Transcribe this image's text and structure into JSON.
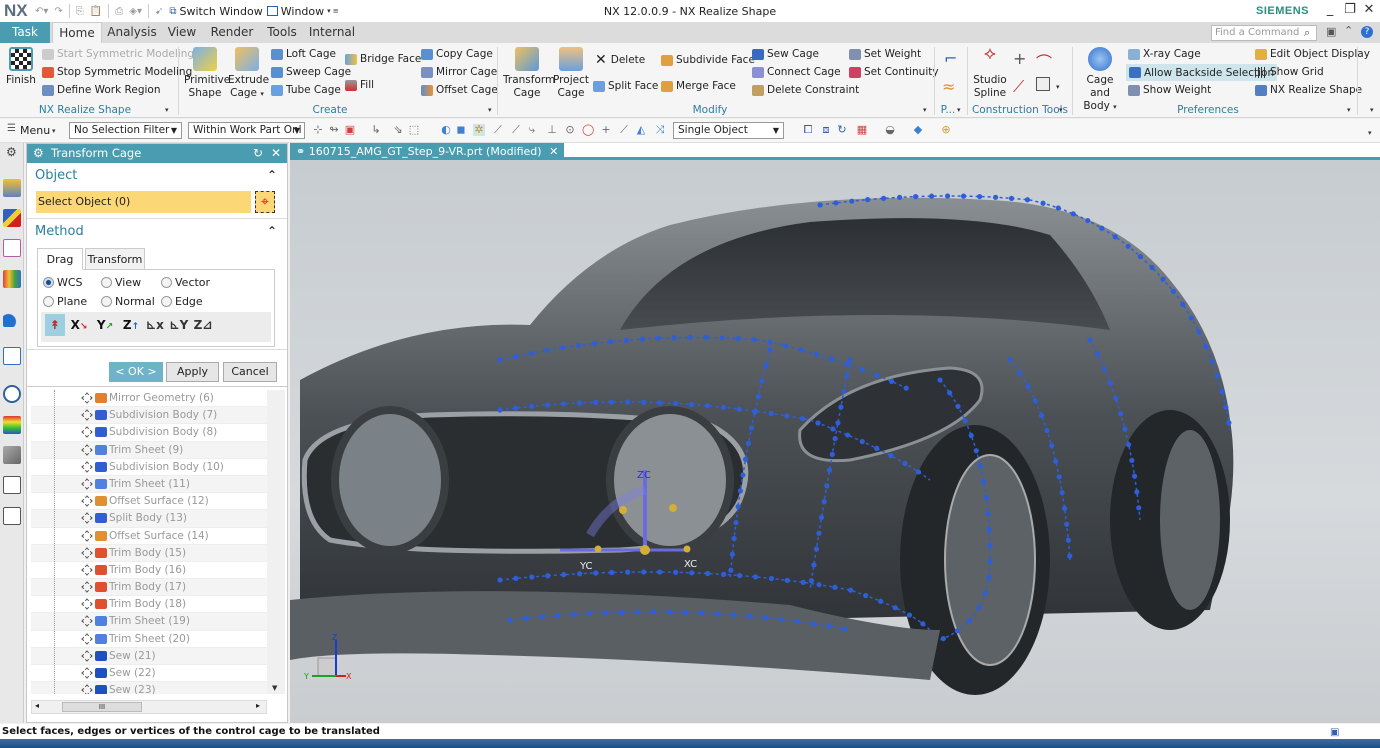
{
  "app": {
    "logo": "NX",
    "title": "NX 12.0.0.9 - NX Realize Shape",
    "brand": "SIEMENS",
    "quick_access": {
      "switch_window": "Switch Window",
      "window": "Window"
    },
    "window_controls": {
      "minimize": "_",
      "restore": "❐",
      "close": "✕"
    }
  },
  "ribbon_tabs": [
    {
      "label": "Task",
      "active": false
    },
    {
      "label": "Home",
      "active": true
    },
    {
      "label": "Analysis"
    },
    {
      "label": "View"
    },
    {
      "label": "Render"
    },
    {
      "label": "Tools"
    },
    {
      "label": "Internal"
    }
  ],
  "find_command": {
    "placeholder": "Find a Command"
  },
  "ribbon": {
    "groups": [
      {
        "label": "NX Realize Shape",
        "big": [
          {
            "label": "Finish"
          }
        ],
        "small": [
          {
            "label": "Start Symmetric Modeling",
            "disabled": true
          },
          {
            "label": "Stop Symmetric Modeling"
          },
          {
            "label": "Define Work Region"
          }
        ]
      },
      {
        "label": "Create",
        "big": [
          {
            "label": "Primitive Shape"
          },
          {
            "label": "Extrude Cage"
          }
        ],
        "small": [
          {
            "label": "Loft Cage"
          },
          {
            "label": "Sweep Cage"
          },
          {
            "label": "Tube Cage"
          },
          {
            "label": "Bridge Face"
          },
          {
            "label": "Fill"
          },
          {
            "label": "Copy Cage"
          },
          {
            "label": "Mirror Cage"
          },
          {
            "label": "Offset Cage"
          }
        ]
      },
      {
        "label": "Modify",
        "big": [
          {
            "label": "Transform Cage"
          },
          {
            "label": "Project Cage"
          }
        ],
        "small": [
          {
            "label": "Delete"
          },
          {
            "label": "Split Face"
          },
          {
            "label": "Subdivide Face"
          },
          {
            "label": "Merge Face"
          },
          {
            "label": "Sew Cage"
          },
          {
            "label": "Connect Cage"
          },
          {
            "label": "Delete Constraint"
          },
          {
            "label": "Set Weight"
          },
          {
            "label": "Set Continuity"
          }
        ]
      },
      {
        "label": "P..."
      },
      {
        "label": "Construction Tools",
        "big": [
          {
            "label": "Studio Spline"
          }
        ]
      },
      {
        "label": "Preferences",
        "big": [
          {
            "label": "Cage and Body"
          }
        ],
        "small": [
          {
            "label": "X-ray Cage"
          },
          {
            "label": "Allow Backside Selection",
            "active": true
          },
          {
            "label": "Show Weight"
          },
          {
            "label": "Edit Object Display"
          },
          {
            "label": "Show Grid"
          },
          {
            "label": "NX Realize Shape"
          }
        ]
      }
    ]
  },
  "toolbar": {
    "menu": "Menu",
    "selection_filter": "No Selection Filter",
    "scope": "Within Work Part Onl",
    "selection_mode": "Single Object"
  },
  "dialog": {
    "title": "Transform Cage",
    "object_section": "Object",
    "select_object": "Select Object (0)",
    "method_section": "Method",
    "tabs": [
      "Drag",
      "Transform"
    ],
    "active_tab": "Drag",
    "radios": [
      {
        "label": "WCS",
        "checked": true
      },
      {
        "label": "View",
        "checked": false
      },
      {
        "label": "Vector",
        "checked": false
      },
      {
        "label": "Plane",
        "checked": false
      },
      {
        "label": "Normal",
        "checked": false
      },
      {
        "label": "Edge",
        "checked": false
      }
    ],
    "axis_buttons": [
      "free",
      "X",
      "Y",
      "Z",
      "XC-plane",
      "YC-plane",
      "ZC-plane"
    ],
    "ok": "< OK >",
    "apply": "Apply",
    "cancel": "Cancel"
  },
  "history_tree": [
    {
      "label": "Mirror Geometry (6)",
      "icon": "mirror-geometry"
    },
    {
      "label": "Subdivision Body (7)",
      "icon": "subdivision-body"
    },
    {
      "label": "Subdivision Body (8)",
      "icon": "subdivision-body"
    },
    {
      "label": "Trim Sheet (9)",
      "icon": "trim-sheet"
    },
    {
      "label": "Subdivision Body (10)",
      "icon": "subdivision-body"
    },
    {
      "label": "Trim Sheet (11)",
      "icon": "trim-sheet"
    },
    {
      "label": "Offset Surface (12)",
      "icon": "offset-surface"
    },
    {
      "label": "Split Body (13)",
      "icon": "split-body"
    },
    {
      "label": "Offset Surface (14)",
      "icon": "offset-surface"
    },
    {
      "label": "Trim Body (15)",
      "icon": "trim-body"
    },
    {
      "label": "Trim Body (16)",
      "icon": "trim-body"
    },
    {
      "label": "Trim Body (17)",
      "icon": "trim-body"
    },
    {
      "label": "Trim Body (18)",
      "icon": "trim-body"
    },
    {
      "label": "Trim Sheet (19)",
      "icon": "trim-sheet"
    },
    {
      "label": "Trim Sheet (20)",
      "icon": "trim-sheet"
    },
    {
      "label": "Sew (21)",
      "icon": "sew"
    },
    {
      "label": "Sew (22)",
      "icon": "sew"
    },
    {
      "label": "Sew (23)",
      "icon": "sew"
    }
  ],
  "document_tab": {
    "label": "160715_AMG_GT_Step_9-VR.prt (Modified)"
  },
  "viewport": {
    "wcs_labels": [
      "ZC",
      "YC",
      "XC"
    ],
    "triad_labels": [
      "Z",
      "Y",
      "X"
    ]
  },
  "status": "Select faces, edges or vertices of the control cage to be translated",
  "colors": {
    "accent": "#4a9db0",
    "selection": "#fbd776",
    "cage": "#2f5fd8",
    "brand": "#20937f"
  }
}
